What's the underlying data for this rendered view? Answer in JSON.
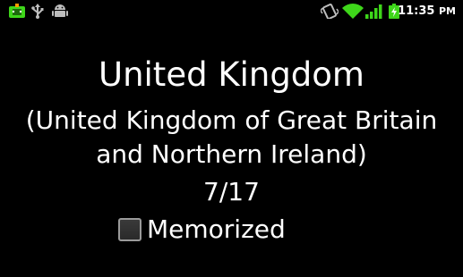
{
  "status_bar": {
    "time": "11:35",
    "meridiem": "PM",
    "left_icons": [
      "android-debug-icon",
      "usb-icon",
      "android-icon"
    ],
    "right_icons": [
      "vibrate-icon",
      "wifi-icon",
      "signal-icon",
      "battery-icon"
    ],
    "colors": {
      "accent_green": "#3ed61a",
      "icon_gray": "#bdbdbd"
    }
  },
  "card": {
    "country": "United Kingdom",
    "full_name_line1": "(United Kingdom of Great Britain",
    "full_name_line2": "and Northern Ireland)",
    "counter": "7/17",
    "memorized_label": "Memorized",
    "memorized_checked": false
  }
}
